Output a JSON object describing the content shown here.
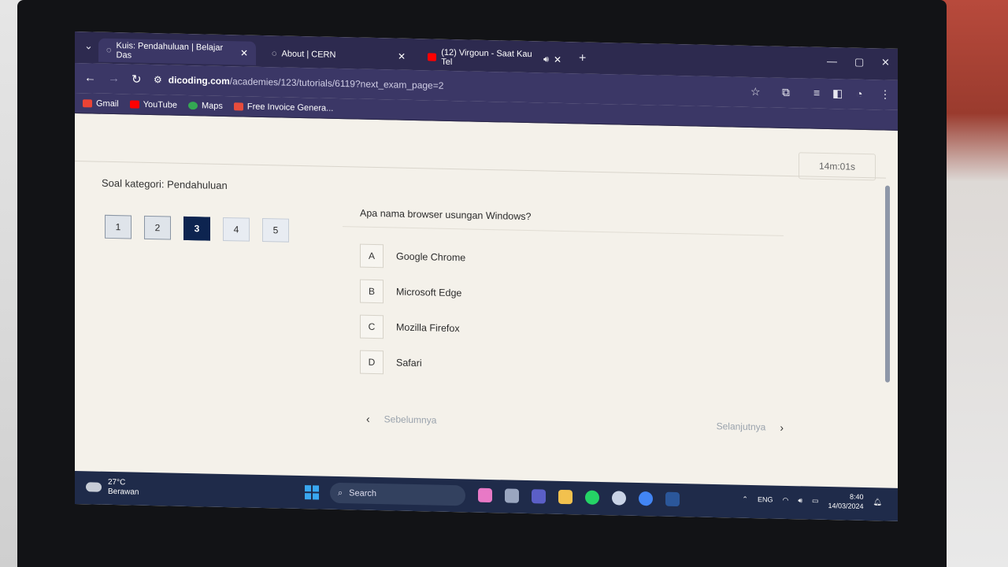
{
  "browser": {
    "tabs": [
      {
        "title": "Kuis: Pendahuluan | Belajar Das",
        "active": true,
        "icon": "dicoding-icon"
      },
      {
        "title": "About | CERN",
        "active": false,
        "icon": "globe-icon"
      },
      {
        "title": "(12) Virgoun - Saat Kau Tel",
        "active": false,
        "icon": "youtube-icon"
      }
    ],
    "new_tab": "+",
    "address": {
      "domain": "dicoding.com",
      "path": "/academies/123/tutorials/6119?next_exam_page=2"
    },
    "bookmarks": [
      {
        "label": "Gmail",
        "icon": "gmail-icon",
        "color": "#ea4335"
      },
      {
        "label": "YouTube",
        "icon": "youtube-icon",
        "color": "#ff0000"
      },
      {
        "label": "Maps",
        "icon": "maps-icon",
        "color": "#34a853"
      },
      {
        "label": "Free Invoice Genera...",
        "icon": "invoice-icon",
        "color": "#e74c3c"
      }
    ]
  },
  "quiz": {
    "timer": "14m:01s",
    "category": "Soal kategori: Pendahuluan",
    "question_numbers": [
      "1",
      "2",
      "3",
      "4",
      "5"
    ],
    "active_question": "3",
    "question": "Apa nama browser usungan Windows?",
    "options": [
      {
        "letter": "A",
        "text": "Google Chrome"
      },
      {
        "letter": "B",
        "text": "Microsoft Edge"
      },
      {
        "letter": "C",
        "text": "Mozilla Firefox"
      },
      {
        "letter": "D",
        "text": "Safari"
      }
    ],
    "prev_label": "Sebelumnya",
    "next_label": "Selanjutnya"
  },
  "taskbar": {
    "temperature": "27°C",
    "weather": "Berawan",
    "search_label": "Search",
    "language": "ENG",
    "time": "8:40",
    "date": "14/03/2024"
  },
  "colors": {
    "chrome_bg": "#3b3766",
    "active_question_bg": "#0d2450",
    "taskbar_bg": "#1f2b4a"
  }
}
